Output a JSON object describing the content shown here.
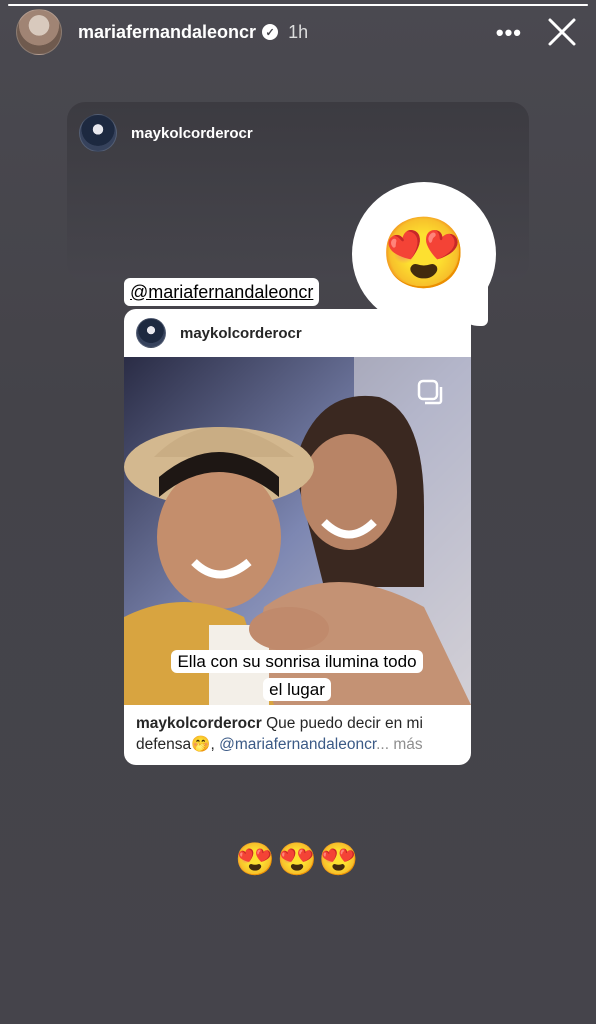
{
  "story": {
    "progress": 1.0,
    "header": {
      "username": "mariafernandaleoncr",
      "verified_icon": "verified-check-icon",
      "time": "1h",
      "more_icon": "more-options-icon",
      "close_icon": "close-icon"
    },
    "reply": {
      "username": "maykolcorderocr",
      "reaction_emoji": "😍"
    },
    "mention_tag": "@mariafernandaleoncr",
    "shared_post": {
      "username": "maykolcorderocr",
      "photo_overlay_text": "Ella con su sonrisa ilumina todo el lugar",
      "caption_user": "maykolcorderocr",
      "caption_text": "Que puedo decir en mi defensa🤭,",
      "caption_mention": "@mariafernandaleoncr",
      "caption_more": "... más",
      "multi_photo_icon": "carousel-icon"
    },
    "bottom_emojis": "😍😍😍"
  }
}
